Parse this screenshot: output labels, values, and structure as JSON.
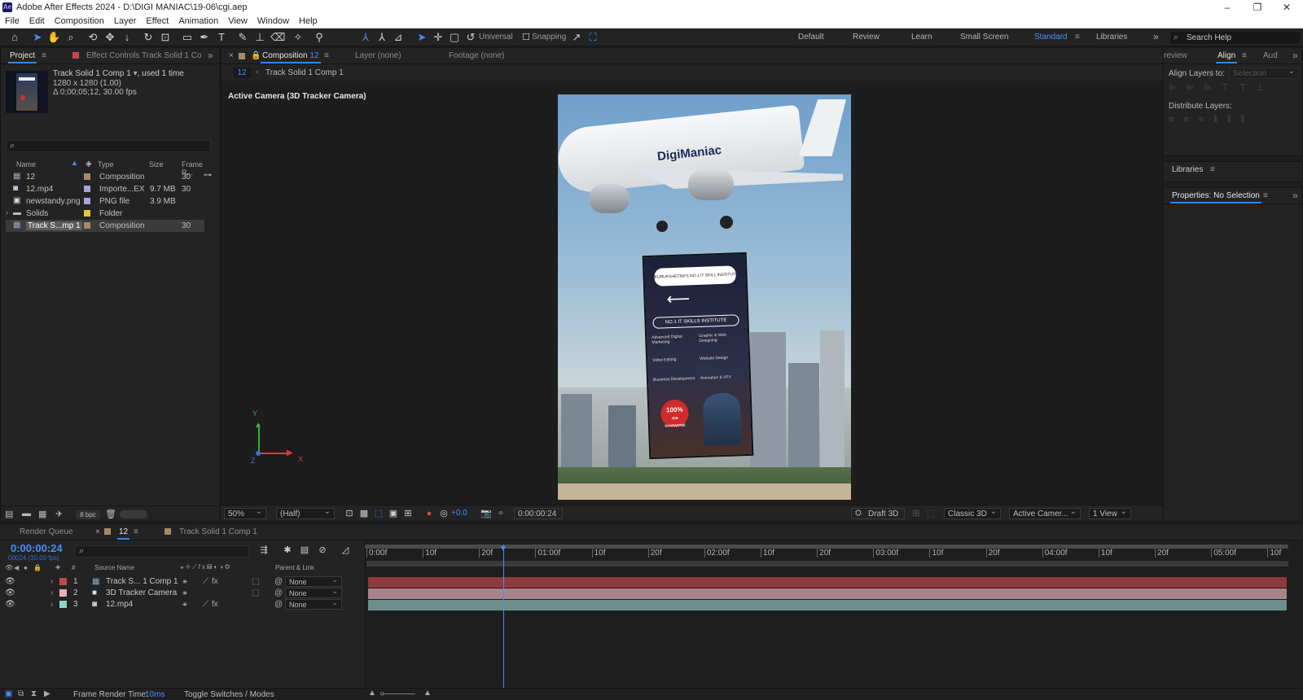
{
  "window": {
    "title": "Adobe After Effects 2024 - D:\\DIGI MANIAC\\19-06\\cgi.aep",
    "app_icon": "Ae"
  },
  "menu": [
    "File",
    "Edit",
    "Composition",
    "Layer",
    "Effect",
    "Animation",
    "View",
    "Window",
    "Help"
  ],
  "toolbar": {
    "universal_label": "Universal",
    "snapping_label": "Snapping"
  },
  "workspaces": [
    "Default",
    "Review",
    "Learn",
    "Small Screen",
    "Standard",
    "Libraries"
  ],
  "active_workspace": "Standard",
  "search_help": {
    "placeholder": "Search Help"
  },
  "project_panel": {
    "tab_project": "Project",
    "tab_effect_controls": "Effect Controls Track Solid 1 Co",
    "info_name": "Track Solid 1 Comp 1",
    "info_used": ", used 1 time",
    "info_size": "1280 x 1280 (1.00)",
    "info_duration": "Δ 0;00;05;12, 30.00 fps",
    "columns": {
      "name": "Name",
      "type": "Type",
      "size": "Size",
      "frame_rate": "Frame R..."
    },
    "items": [
      {
        "name": "12",
        "type": "Composition",
        "size": "",
        "frame_rate": "30",
        "color": "#a6896b",
        "icon": "composition-icon"
      },
      {
        "name": "12.mp4",
        "type": "Importe...EX",
        "size": "9.7 MB",
        "frame_rate": "30",
        "color": "#a7a4d8",
        "icon": "video-file-icon"
      },
      {
        "name": "newstandy.png",
        "type": "PNG file",
        "size": "3.9 MB",
        "frame_rate": "",
        "color": "#a7a4d8",
        "icon": "image-file-icon"
      },
      {
        "name": "Solids",
        "type": "Folder",
        "size": "",
        "frame_rate": "",
        "color": "#e3c53a",
        "icon": "folder-icon"
      },
      {
        "name": "Track S...mp 1",
        "type": "Composition",
        "size": "",
        "frame_rate": "30",
        "color": "#a6896b",
        "icon": "composition-icon"
      }
    ],
    "bpc": "8 bpc"
  },
  "composition_panel": {
    "tab_composition": "Composition",
    "tab_composition_name": "12",
    "tab_layer": "Layer (none)",
    "tab_footage": "Footage (none)",
    "breadcrumb_current": "12",
    "breadcrumb_child": "Track Solid 1 Comp 1",
    "camera_label": "Active Camera (3D Tracker Camera)",
    "axis_y": "Y",
    "axis_x": "X",
    "axis_z": "Z",
    "poster_text": {
      "brand": "DigiManiac",
      "headline": "NO.1 IT SKILLS INSTITUTE",
      "topline": "KURUKSHETRA'S NO.1 IT SKILL INSTITUTE",
      "courses": [
        "Advanced Digital Marketing",
        "Graphic & Web Designing",
        "Video Editing",
        "Website Design",
        "Business Development",
        "Animation & VFX"
      ],
      "badge": "100%",
      "badge_sub": "JOB GUARANTEE"
    },
    "zoom": "50%",
    "resolution": "(Half)",
    "exposure": "+0.0",
    "timecode": "0:00:00:24",
    "renderer_draft": "Draft 3D",
    "renderer": "Classic 3D",
    "view_camera": "Active Camer...",
    "view_layout": "1 View"
  },
  "right_panels": {
    "tab_preview": "review",
    "tab_align": "Align",
    "tab_audio": "Aud",
    "align_layers_to_label": "Align Layers to:",
    "align_layers_to_value": "Selection",
    "distribute_layers_label": "Distribute Layers:",
    "libraries": "Libraries",
    "properties": "Properties: No Selection"
  },
  "timeline": {
    "tab_render_queue": "Render Queue",
    "tab_comp": "12",
    "tab_track_comp": "Track Solid 1 Comp 1",
    "current_time": "0:00:00:24",
    "current_frame": "00024 (30.00 fps)",
    "columns": {
      "number": "#",
      "source_name": "Source Name",
      "parent": "Parent & Link"
    },
    "layers": [
      {
        "index": "1",
        "name": "Track S... 1 Comp 1",
        "parent": "None",
        "color": "#c44747",
        "bar": "#8e3a3c",
        "icon": "composition-icon"
      },
      {
        "index": "2",
        "name": "3D Tracker Camera",
        "parent": "None",
        "color": "#e5b2b8",
        "bar": "#a9838a",
        "icon": "camera-icon"
      },
      {
        "index": "3",
        "name": "12.mp4",
        "parent": "None",
        "color": "#8fd3c4",
        "bar": "#6e8f8a",
        "icon": "video-file-icon"
      }
    ],
    "ruler": [
      "0:00f",
      "10f",
      "20f",
      "01:00f",
      "10f",
      "20f",
      "02:00f",
      "10f",
      "20f",
      "03:00f",
      "10f",
      "20f",
      "04:00f",
      "10f",
      "20f",
      "05:00f",
      "10f"
    ],
    "playhead_seconds": 0.8,
    "duration_seconds": 5.4
  },
  "statusbar": {
    "frame_render_label": "Frame Render Time:",
    "frame_render_value": "10ms",
    "toggle_label": "Toggle Switches / Modes"
  }
}
